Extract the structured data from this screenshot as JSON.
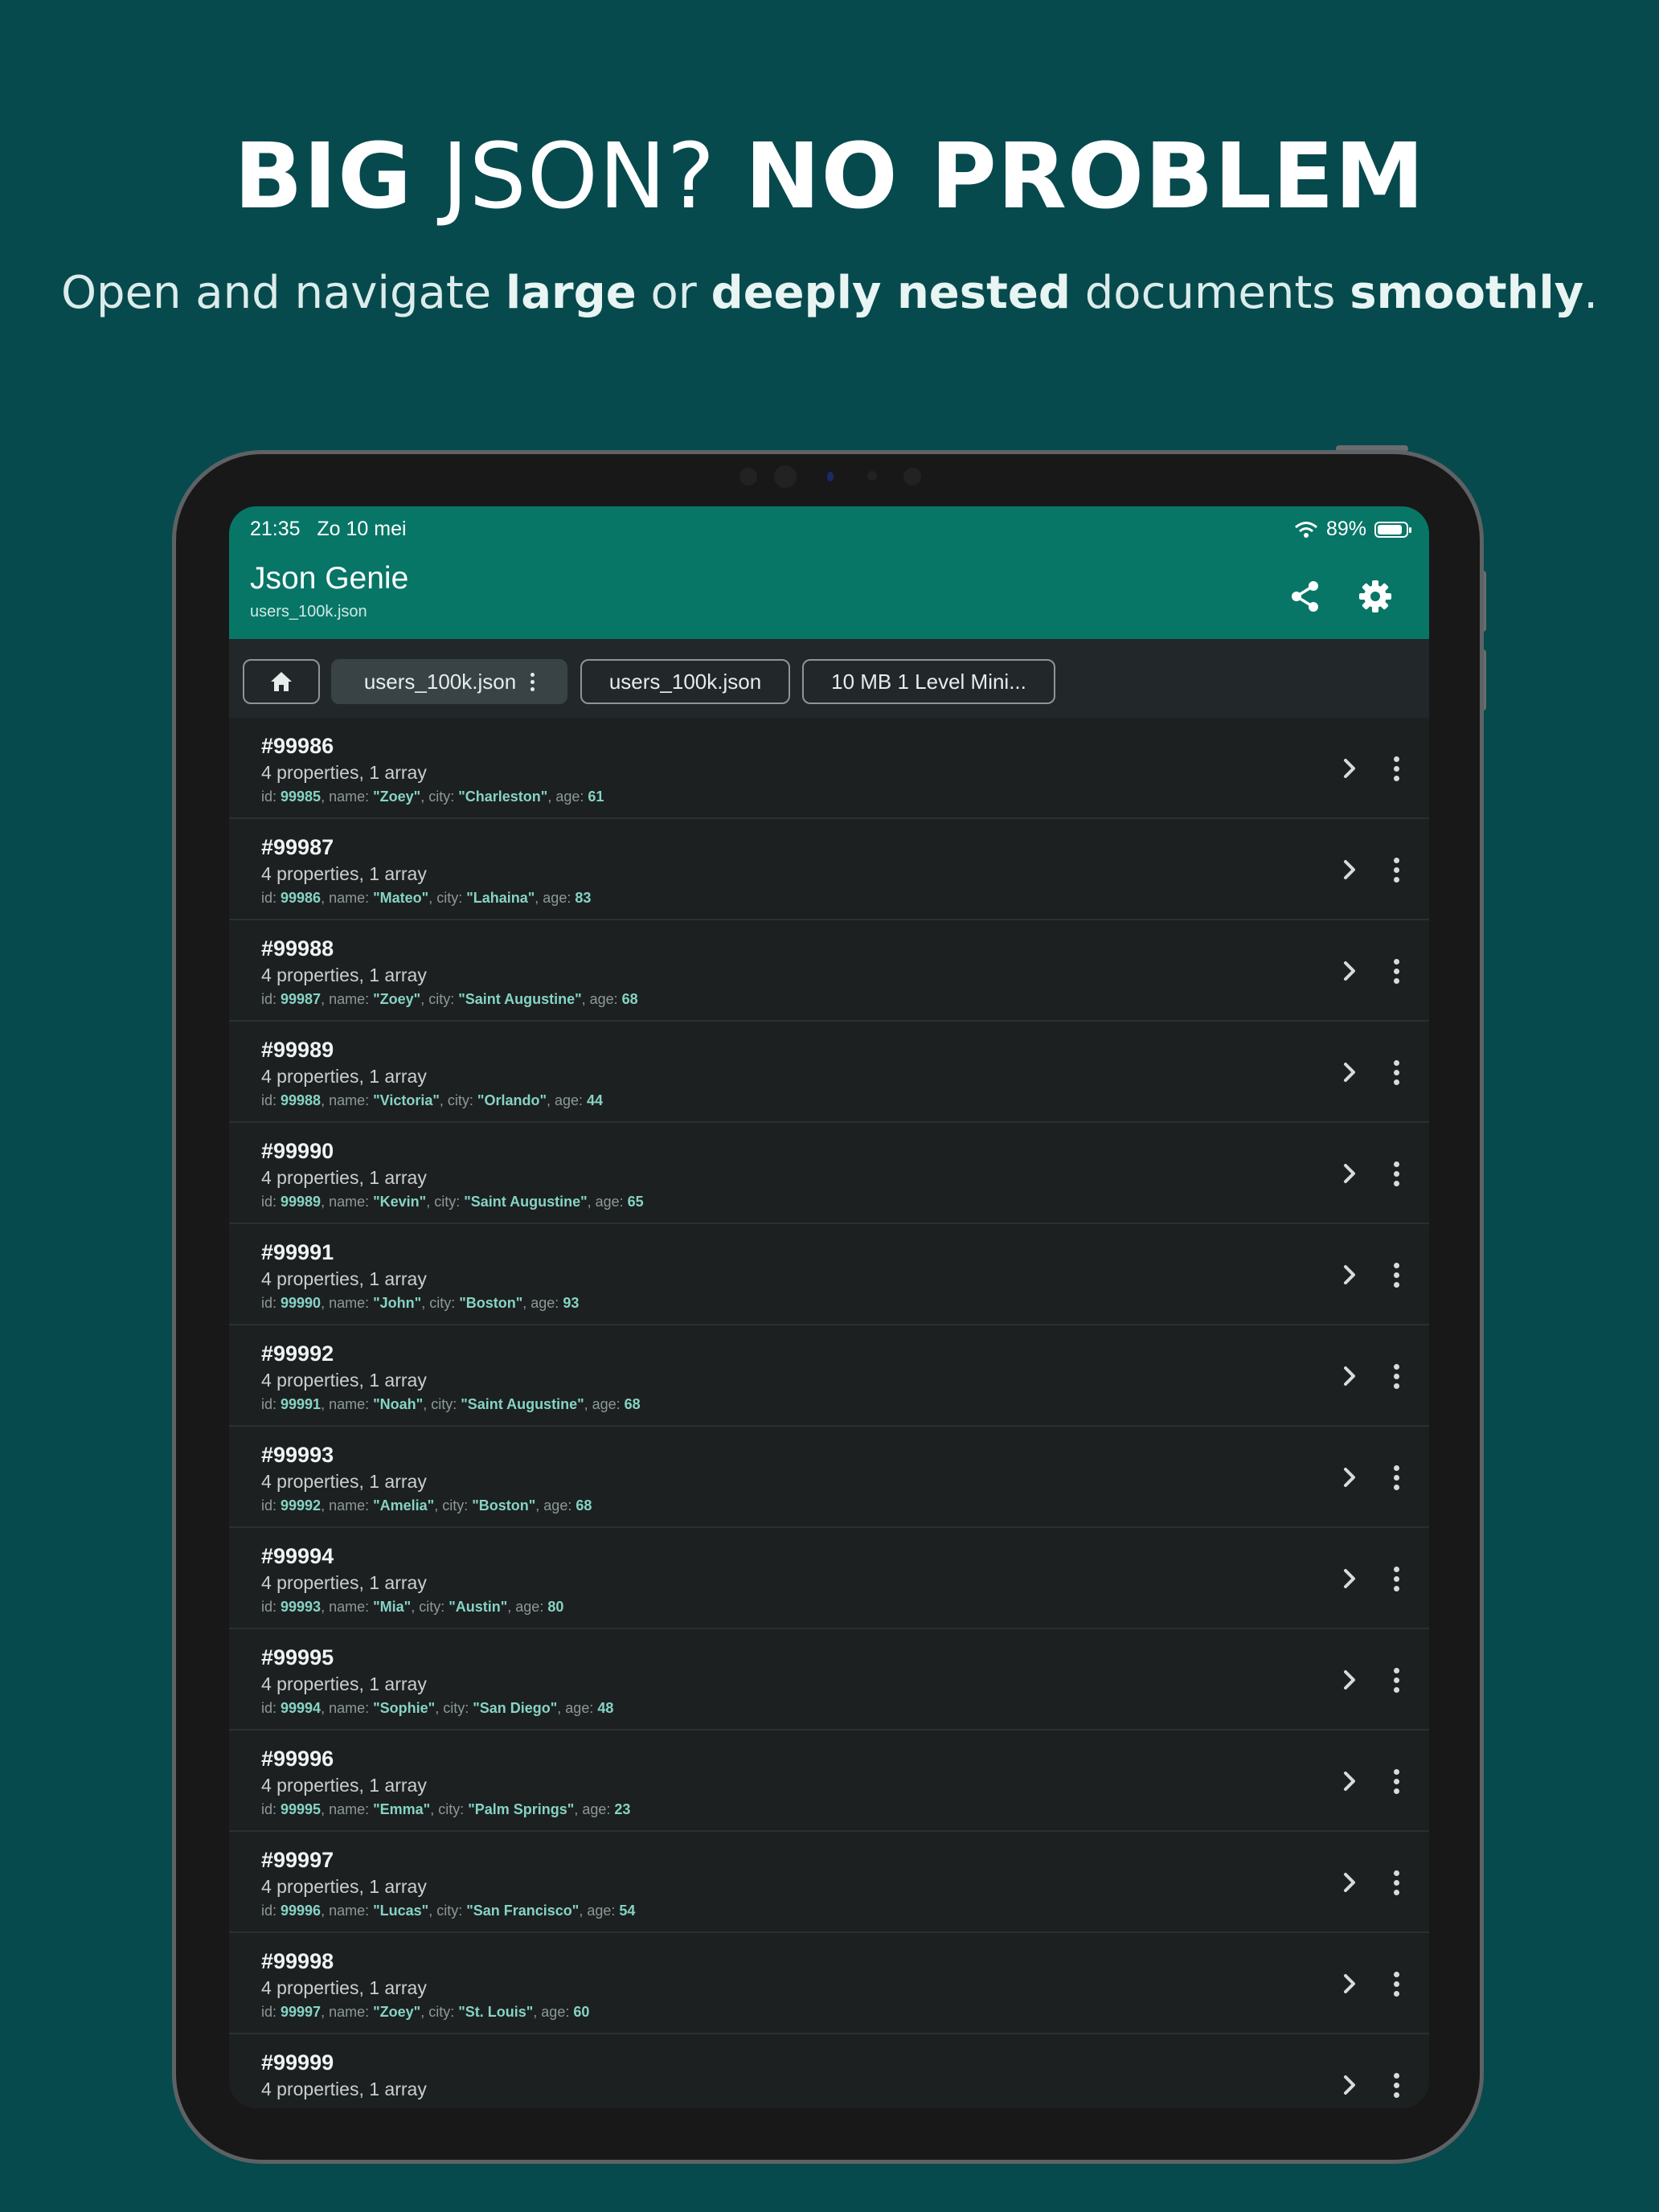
{
  "headline": {
    "part1": "BIG",
    "part2": "JSON?",
    "part3": "NO PROBLEM"
  },
  "subline": {
    "t1": "Open and navigate ",
    "b1": "large",
    "t2": " or ",
    "b2": "deeply nested",
    "t3": " documents ",
    "b3": "smoothly",
    "t4": "."
  },
  "status_bar": {
    "time": "21:35",
    "date": "Zo 10 mei",
    "battery": "89%",
    "battery_level": 0.89
  },
  "app_bar": {
    "title": "Json Genie",
    "subtitle": "users_100k.json",
    "share_icon": "share-icon",
    "settings_icon": "gear-icon"
  },
  "breadcrumbs": {
    "home_icon": "home-icon",
    "items": [
      "users_100k.json",
      "users_100k.json",
      "10 MB 1 Level Mini..."
    ]
  },
  "list": {
    "summary_label": "4 properties, 1 array",
    "items": [
      {
        "title": "#99986",
        "id": "99985",
        "name": "\"Zoey\"",
        "city": "\"Charleston\"",
        "age": "61"
      },
      {
        "title": "#99987",
        "id": "99986",
        "name": "\"Mateo\"",
        "city": "\"Lahaina\"",
        "age": "83"
      },
      {
        "title": "#99988",
        "id": "99987",
        "name": "\"Zoey\"",
        "city": "\"Saint Augustine\"",
        "age": "68"
      },
      {
        "title": "#99989",
        "id": "99988",
        "name": "\"Victoria\"",
        "city": "\"Orlando\"",
        "age": "44"
      },
      {
        "title": "#99990",
        "id": "99989",
        "name": "\"Kevin\"",
        "city": "\"Saint Augustine\"",
        "age": "65"
      },
      {
        "title": "#99991",
        "id": "99990",
        "name": "\"John\"",
        "city": "\"Boston\"",
        "age": "93"
      },
      {
        "title": "#99992",
        "id": "99991",
        "name": "\"Noah\"",
        "city": "\"Saint Augustine\"",
        "age": "68"
      },
      {
        "title": "#99993",
        "id": "99992",
        "name": "\"Amelia\"",
        "city": "\"Boston\"",
        "age": "68"
      },
      {
        "title": "#99994",
        "id": "99993",
        "name": "\"Mia\"",
        "city": "\"Austin\"",
        "age": "80"
      },
      {
        "title": "#99995",
        "id": "99994",
        "name": "\"Sophie\"",
        "city": "\"San Diego\"",
        "age": "48"
      },
      {
        "title": "#99996",
        "id": "99995",
        "name": "\"Emma\"",
        "city": "\"Palm Springs\"",
        "age": "23"
      },
      {
        "title": "#99997",
        "id": "99996",
        "name": "\"Lucas\"",
        "city": "\"San Francisco\"",
        "age": "54"
      },
      {
        "title": "#99998",
        "id": "99997",
        "name": "\"Zoey\"",
        "city": "\"St. Louis\"",
        "age": "60"
      },
      {
        "title": "#99999",
        "id": "",
        "name": "",
        "city": "",
        "age": ""
      }
    ]
  }
}
